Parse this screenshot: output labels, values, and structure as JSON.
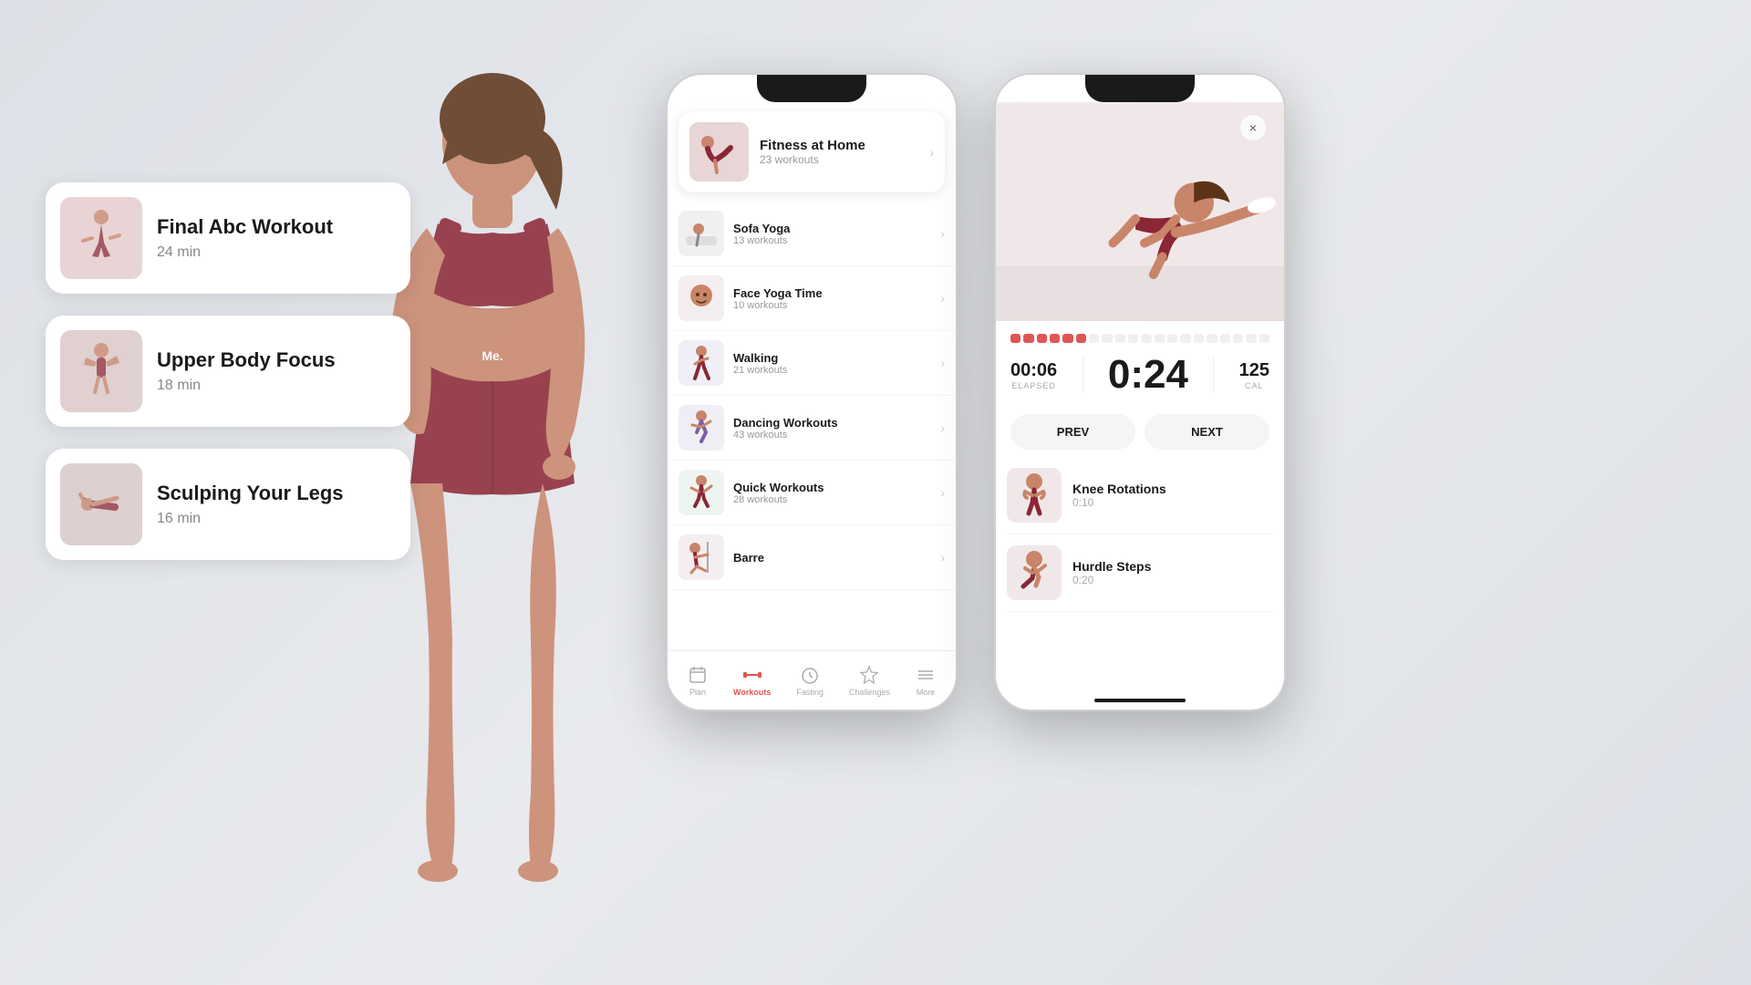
{
  "background_color": "#e2e5ea",
  "person": {
    "brand": "Me.",
    "description": "Fitness woman in dark red outfit"
  },
  "workout_cards": [
    {
      "title": "Final Abc Workout",
      "duration": "24 min",
      "img_color": "#e8d0d0"
    },
    {
      "title": "Upper Body Focus",
      "duration": "18 min",
      "img_color": "#e8d8d8"
    },
    {
      "title": "Sculping Your Legs",
      "duration": "16 min",
      "img_color": "#e0d8d8"
    }
  ],
  "phone1": {
    "featured": {
      "title": "Fitness at Home",
      "subtitle": "23 workouts"
    },
    "list": [
      {
        "title": "Sofa Yoga",
        "subtitle": "13 workouts"
      },
      {
        "title": "Face Yoga Time",
        "subtitle": "10 workouts"
      },
      {
        "title": "Walking",
        "subtitle": "21 workouts"
      },
      {
        "title": "Dancing Workouts",
        "subtitle": "43 workouts"
      },
      {
        "title": "Quick Workouts",
        "subtitle": "28 workouts"
      },
      {
        "title": "Barre",
        "subtitle": ""
      }
    ],
    "nav": [
      {
        "label": "Plan",
        "icon": "calendar",
        "active": false
      },
      {
        "label": "Workouts",
        "icon": "dumbbell",
        "active": true
      },
      {
        "label": "Fasting",
        "icon": "clock",
        "active": false
      },
      {
        "label": "Challenges",
        "icon": "star",
        "active": false
      },
      {
        "label": "More",
        "icon": "menu",
        "active": false
      }
    ]
  },
  "phone2": {
    "close_label": "×",
    "progress": {
      "filled": 6,
      "total": 20
    },
    "elapsed": "00:06",
    "elapsed_label": "ELAPSED",
    "timer": "0:24",
    "calories": "125",
    "cal_label": "CAL",
    "prev_label": "PREV",
    "next_label": "NEXT",
    "exercises": [
      {
        "title": "Knee Rotations",
        "duration": "0:10"
      },
      {
        "title": "Hurdle Steps",
        "duration": "0:20"
      }
    ]
  }
}
